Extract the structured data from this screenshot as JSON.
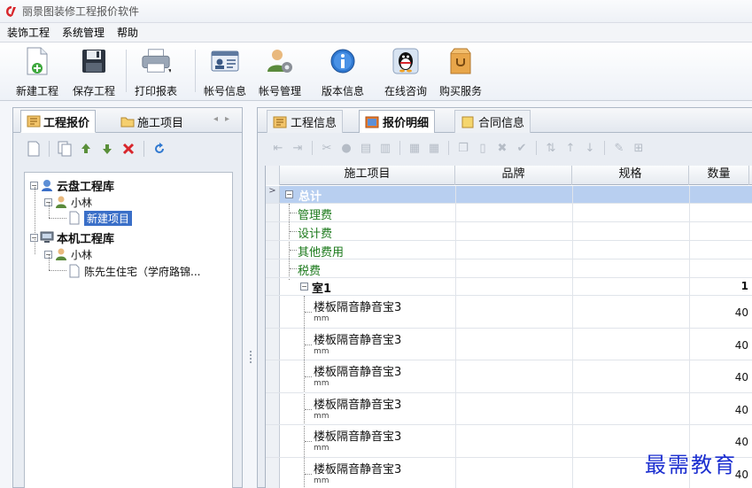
{
  "app": {
    "title": "丽景图装修工程报价软件"
  },
  "menu": [
    "装饰工程",
    "系统管理",
    "帮助"
  ],
  "toolbar": [
    {
      "label": "新建工程",
      "icon": "new-document-icon"
    },
    {
      "label": "保存工程",
      "icon": "save-disk-icon"
    },
    {
      "label": "打印报表",
      "icon": "printer-icon"
    },
    {
      "label": "帐号信息",
      "icon": "id-card-icon"
    },
    {
      "label": "帐号管理",
      "icon": "user-gear-icon"
    },
    {
      "label": "版本信息",
      "icon": "info-icon"
    },
    {
      "label": "在线咨询",
      "icon": "qq-penguin-icon"
    },
    {
      "label": "购买服务",
      "icon": "shopping-bag-icon"
    }
  ],
  "left_tabs": [
    "工程报价",
    "施工项目"
  ],
  "tree": {
    "cloud_lib": "云盘工程库",
    "cloud_user": "小林",
    "cloud_project": "新建项目",
    "local_lib": "本机工程库",
    "local_user": "小林",
    "local_project": "陈先生住宅（学府路锦..."
  },
  "right_tabs": [
    "工程信息",
    "报价明细",
    "合同信息"
  ],
  "grid": {
    "columns": [
      "施工项目",
      "品牌",
      "规格",
      "数量"
    ],
    "total_label": "总计",
    "fees": [
      "管理费",
      "设计费",
      "其他费用",
      "税费"
    ],
    "room": {
      "name": "室1",
      "qty": "1"
    },
    "items": [
      {
        "name": "楼板隔音静音宝3",
        "unit": "mm",
        "qty": "40"
      },
      {
        "name": "楼板隔音静音宝3",
        "unit": "mm",
        "qty": "40"
      },
      {
        "name": "楼板隔音静音宝3",
        "unit": "mm",
        "qty": "40"
      },
      {
        "name": "楼板隔音静音宝3",
        "unit": "mm",
        "qty": "40"
      },
      {
        "name": "楼板隔音静音宝3",
        "unit": "mm",
        "qty": "40"
      },
      {
        "name": "楼板隔音静音宝3",
        "unit": "mm",
        "qty": "40"
      }
    ]
  },
  "watermark": "最需教育"
}
